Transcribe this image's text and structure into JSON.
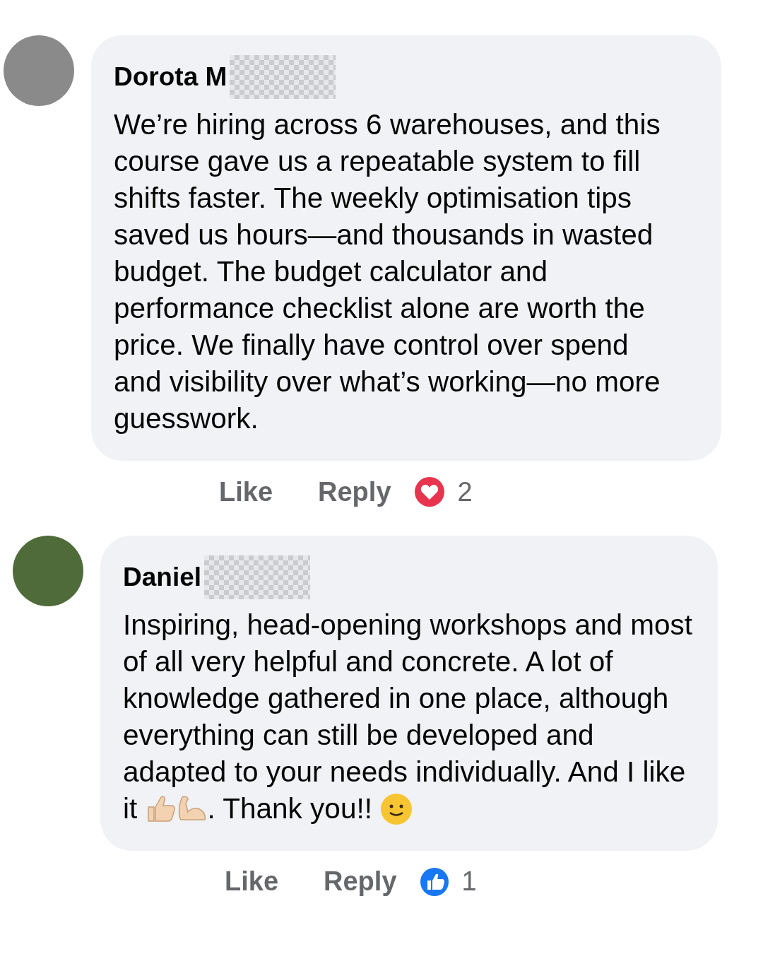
{
  "comments": [
    {
      "author": "Dorota M",
      "author_redacted": true,
      "body": [
        {
          "kind": "text",
          "text": "We’re hiring across 6 warehouses, and this course gave us a repeatable system to fill shifts faster. The weekly optimisation tips saved us hours—and thousands in wasted budget. The budget calculator and performance checklist alone are worth the price. We finally have control over spend and visibility over what’s working—no more guesswork."
        }
      ],
      "actions": [
        "Like",
        "Reply"
      ],
      "reaction": {
        "kind": "love",
        "count": "2"
      }
    },
    {
      "author": "Daniel",
      "author_redacted": true,
      "body": [
        {
          "kind": "text",
          "text": "Inspiring, head-opening workshops and most of all very helpful and concrete. A lot of knowledge gathered in one place, although everything can still be developed and adapted to your needs individually. And I like it "
        },
        {
          "kind": "thumbs_up"
        },
        {
          "kind": "flexed_arm"
        },
        {
          "kind": "text",
          "text": ". Thank you!! "
        },
        {
          "kind": "smile"
        }
      ],
      "actions": [
        "Like",
        "Reply"
      ],
      "reaction": {
        "kind": "like",
        "count": "1"
      }
    }
  ]
}
